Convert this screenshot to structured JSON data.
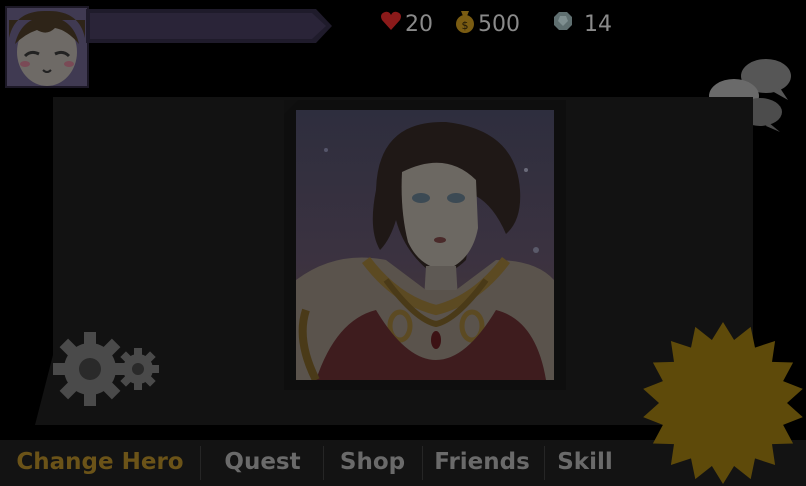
{
  "player": {
    "avatar": "hero-avatar"
  },
  "resources": {
    "hearts": {
      "icon": "heart-icon",
      "value": "20",
      "color": "#8b1a1a"
    },
    "gold": {
      "icon": "money-bag-icon",
      "value": "500",
      "color": "#7a5c12"
    },
    "gems": {
      "icon": "gem-icon",
      "value": "14",
      "color": "#5f6f70"
    }
  },
  "portrait": {
    "subject": "hero-portrait"
  },
  "nav": {
    "tabs": [
      {
        "label": "Change Hero",
        "active": true
      },
      {
        "label": "Quest"
      },
      {
        "label": "Shop"
      },
      {
        "label": "Friends"
      },
      {
        "label": "Skill"
      }
    ]
  },
  "colors": {
    "accent": "#6b5318",
    "burst": "#5e4a0a",
    "panel": "#121212"
  }
}
